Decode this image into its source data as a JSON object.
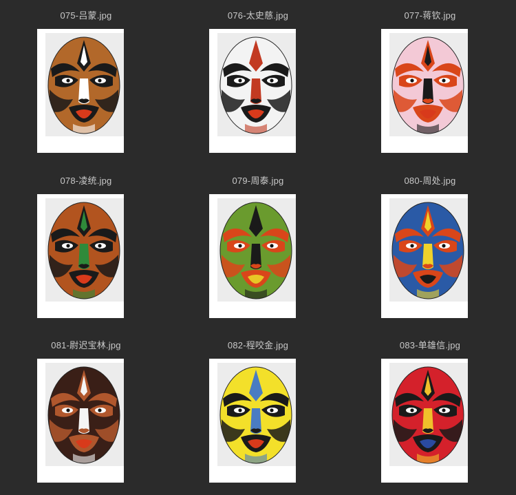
{
  "files": [
    {
      "name": "075-吕蒙.jpg",
      "colors": {
        "base": "#b2682a",
        "accent": "#1a1a1a",
        "detail": "#ffffff",
        "mouth": "#d83a1b"
      }
    },
    {
      "name": "076-太史慈.jpg",
      "colors": {
        "base": "#f3f3f3",
        "accent": "#1a1a1a",
        "detail": "#c23a22",
        "mouth": "#d83a1b"
      }
    },
    {
      "name": "077-蒋钦.jpg",
      "colors": {
        "base": "#f3c9d6",
        "accent": "#d9461a",
        "detail": "#1a1a1a",
        "mouth": "#d83a1b"
      }
    },
    {
      "name": "078-凌统.jpg",
      "colors": {
        "base": "#b2541f",
        "accent": "#1a1a1a",
        "detail": "#2f8a3a",
        "mouth": "#d83a1b"
      }
    },
    {
      "name": "079-周泰.jpg",
      "colors": {
        "base": "#6a9b2e",
        "accent": "#d9461a",
        "detail": "#1a1a1a",
        "mouth": "#e8c626"
      }
    },
    {
      "name": "080-周处.jpg",
      "colors": {
        "base": "#2a5aa6",
        "accent": "#d9461a",
        "detail": "#f0d22b",
        "mouth": "#1a1a1a"
      }
    },
    {
      "name": "081-尉迟宝林.jpg",
      "colors": {
        "base": "#3a1f17",
        "accent": "#b0572d",
        "detail": "#f5f5f5",
        "mouth": "#d83a1b"
      }
    },
    {
      "name": "082-程咬金.jpg",
      "colors": {
        "base": "#f3e02a",
        "accent": "#1a1a1a",
        "detail": "#4a7cc2",
        "mouth": "#d83a1b"
      }
    },
    {
      "name": "083-单雄信.jpg",
      "colors": {
        "base": "#d4212b",
        "accent": "#1a1a1a",
        "detail": "#f0c02b",
        "mouth": "#2a4aa0"
      }
    }
  ]
}
